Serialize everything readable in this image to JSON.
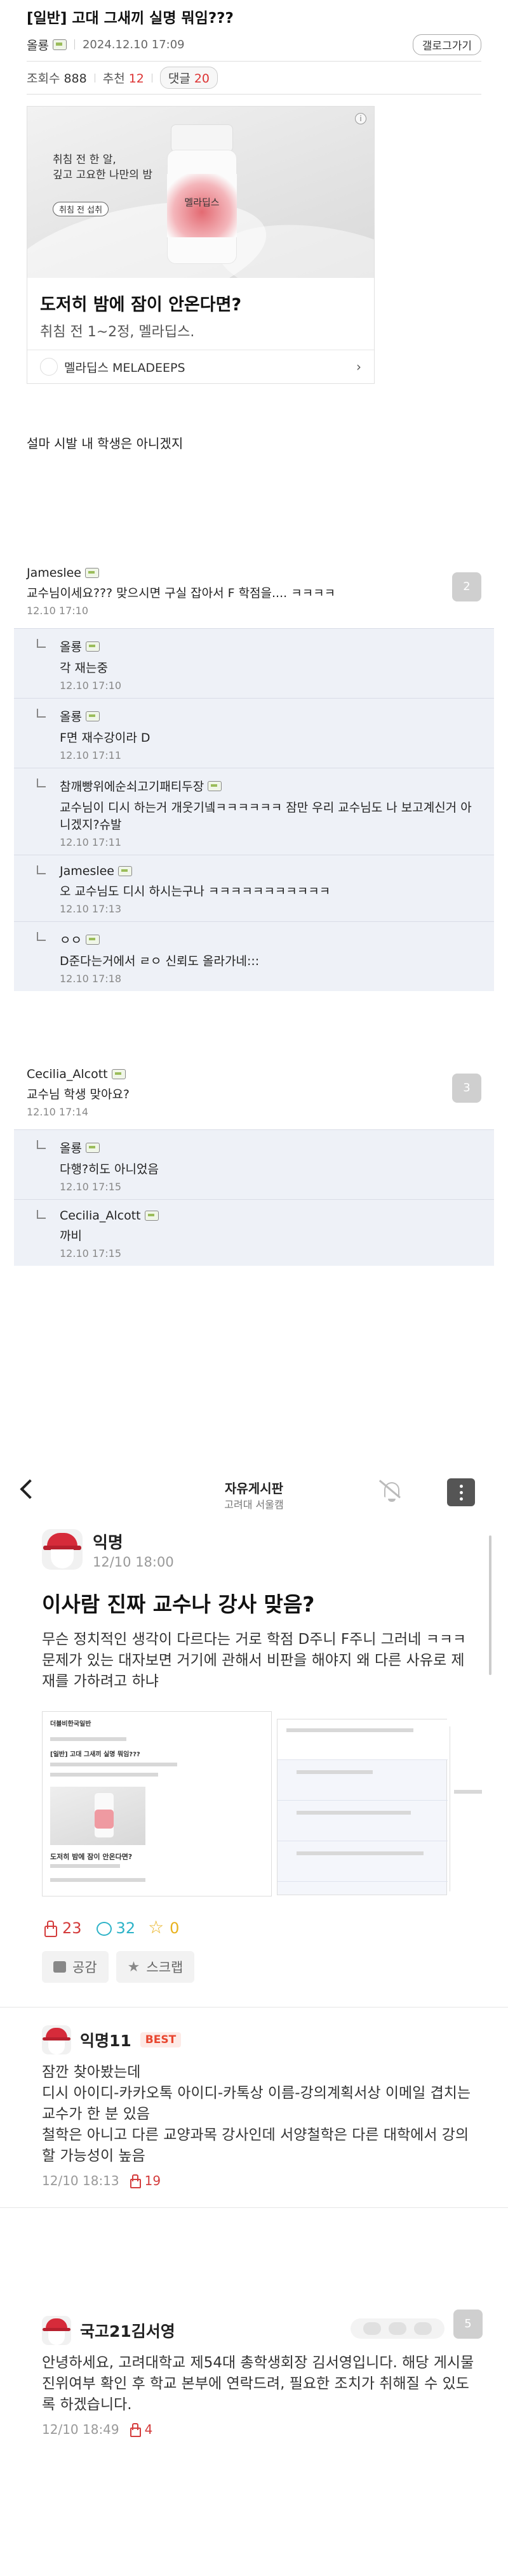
{
  "post": {
    "title": "[일반] 고대 그새끼 실명 뭐임???",
    "author": "올룡",
    "date": "2024.12.10 17:09",
    "gallery_button": "갤로그가기",
    "views_label": "조회수",
    "views": "888",
    "recommend_label": "추천",
    "recommend": "12",
    "comments_label": "댓글",
    "comments": "20",
    "body": "설마 시발 내 학생은 아니겠지"
  },
  "ad": {
    "image_text_line1": "취침 전 한 알,",
    "image_text_line2": "깊고 고요한 나만의 밤",
    "image_pill": "취침 전 섭취",
    "bottle_brand": "멜라딥스",
    "info": "i",
    "headline": "도저히 밤에 잠이 안온다면?",
    "subline": "취침 전 1~2정, 멜라딥스.",
    "brand_footer": "멜라딥스 MELADEEPS",
    "chevron": "›"
  },
  "comment_threads": [
    {
      "author": "Jameslee",
      "text": "교수님이세요??? 맞으시면 구실 잡아서 F 학점을.... ㅋㅋㅋㅋ",
      "time": "12.10 17:10",
      "count": "2",
      "replies": [
        {
          "author": "올룡",
          "text": "각 재는중",
          "time": "12.10 17:10"
        },
        {
          "author": "올룡",
          "text": "F면 재수강이라 D",
          "time": "12.10 17:11"
        },
        {
          "author": "참깨빵위에순쇠고기패티두장",
          "text": "교수님이 디시 하는거 개웃기넼ㅋㅋㅋㅋㅋㅋ 잠만 우리 교수님도 나 보고계신거 아니겠지?슈발",
          "time": "12.10 17:11"
        },
        {
          "author": "Jameslee",
          "text": "오 교수님도 디시 하시는구나 ㅋㅋㅋㅋㅋㅋㅋㅋㅋㅋㅋ",
          "time": "12.10 17:13"
        },
        {
          "author": "ㅇㅇ",
          "text": "D준다는거에서 ㄹㅇ 신뢰도 올라가네:::",
          "time": "12.10 17:18"
        }
      ]
    },
    {
      "author": "Cecilia_Alcott",
      "text": "교수님 학생 맞아요?",
      "time": "12.10 17:14",
      "count": "3",
      "replies": [
        {
          "author": "올룡",
          "text": "다행?히도 아니었음",
          "time": "12.10 17:15"
        },
        {
          "author": "Cecilia_Alcott",
          "text": "까비",
          "time": "12.10 17:15"
        }
      ]
    }
  ],
  "app": {
    "board_title": "자유게시판",
    "board_sub": "고려대 서울캠",
    "post": {
      "author": "익명",
      "date": "12/10 18:00",
      "title": "이사람 진짜 교수나 강사 맞음?",
      "body": "무슨 정치적인 생각이 다르다는 거로 학점 D주니 F주니 그러네 ㅋㅋㅋ\n문제가 있는 대자보면 거기에 관해서 비판을 해야지 왜 다른 사유로 제재를 가하려고 하냐",
      "likes": "23",
      "comments": "32",
      "scraps": "0",
      "like_button": "공감",
      "scrap_button": "스크랩"
    },
    "comment1": {
      "author": "익명11",
      "badge": "BEST",
      "text": "잠깐 찾아봤는데\n디시 아이디-카카오톡 아이디-카톡상 이름-강의계획서상 이메일 겹치는 교수가 한 분 있음\n철학은 아니고 다른 교양과목 강사인데 서양철학은 다른 대학에서 강의할 가능성이 높음",
      "time": "12/10 18:13",
      "likes": "19"
    },
    "comment2": {
      "author": "국고21김서영",
      "text": "안녕하세요, 고려대학교 제54대 총학생회장 김서영입니다. 해당 게시물 진위여부 확인 후 학교 본부에 연락드려, 필요한 조치가 취해질 수 있도록 하겠습니다.",
      "time": "12/10 18:49",
      "likes": "4",
      "page": "5"
    },
    "screenshot": {
      "line1": "더블비한국일반",
      "line2": "[일반] 고대 그새끼 실명 뭐임???",
      "line3": "도저히 밤에 잠이 안온다면?"
    }
  },
  "colors": {
    "accent_red": "#d43c3c",
    "reply_bg": "#eef1f7",
    "best": "#e8462f"
  }
}
